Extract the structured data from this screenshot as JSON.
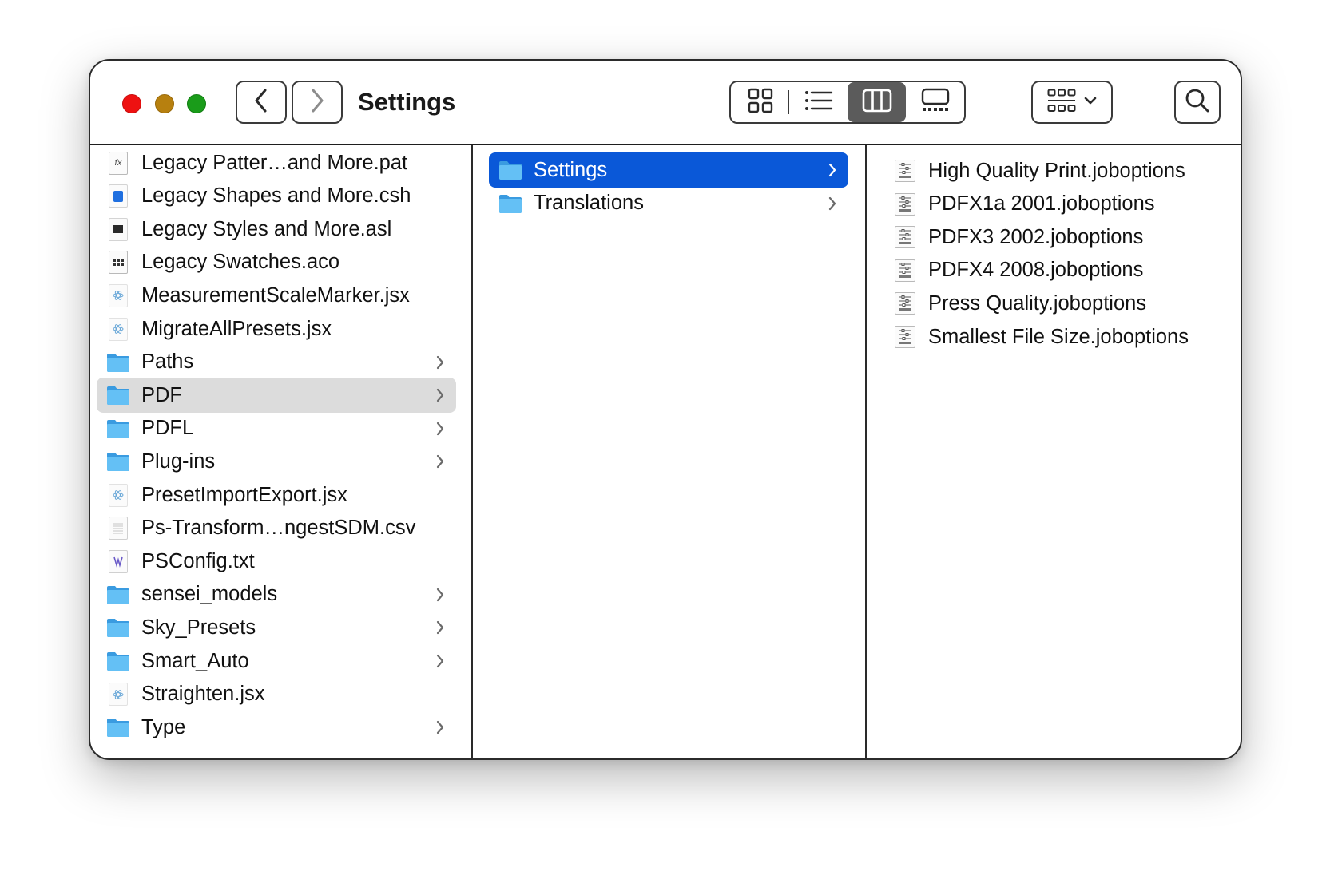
{
  "window": {
    "title": "Settings"
  },
  "toolbar": {
    "back_icon": "chevron-left-icon",
    "forward_icon": "chevron-right-icon",
    "views": [
      {
        "name": "icon-view",
        "icon": "grid-icon",
        "active": false
      },
      {
        "name": "list-view",
        "icon": "list-icon",
        "active": false
      },
      {
        "name": "column-view",
        "icon": "columns-icon",
        "active": true
      },
      {
        "name": "gallery-view",
        "icon": "gallery-icon",
        "active": false
      }
    ],
    "group_icon": "group-grid-icon",
    "search_icon": "search-icon"
  },
  "colors": {
    "selection_blue": "#0a58d8",
    "selection_gray": "#dcdcdc",
    "folder_blue": "#52b5f0",
    "close_red": "#ee1111",
    "minimize_yellow": "#b7800f",
    "zoom_green": "#1a9c1a"
  },
  "column1": {
    "items": [
      {
        "label": "Legacy Patter…and More.pat",
        "kind": "pattern-file",
        "has_children": false
      },
      {
        "label": "Legacy Shapes and More.csh",
        "kind": "shapes-file",
        "has_children": false
      },
      {
        "label": "Legacy Styles and More.asl",
        "kind": "styles-file",
        "has_children": false
      },
      {
        "label": "Legacy Swatches.aco",
        "kind": "swatch-file",
        "has_children": false
      },
      {
        "label": "MeasurementScaleMarker.jsx",
        "kind": "script-file",
        "has_children": false
      },
      {
        "label": "MigrateAllPresets.jsx",
        "kind": "script-file",
        "has_children": false
      },
      {
        "label": "Paths",
        "kind": "folder",
        "has_children": true
      },
      {
        "label": "PDF",
        "kind": "folder",
        "has_children": true,
        "selected": true
      },
      {
        "label": "PDFL",
        "kind": "folder",
        "has_children": true
      },
      {
        "label": "Plug-ins",
        "kind": "folder",
        "has_children": true
      },
      {
        "label": "PresetImportExport.jsx",
        "kind": "script-file",
        "has_children": false
      },
      {
        "label": "Ps-Transform…ngestSDM.csv",
        "kind": "csv-file",
        "has_children": false
      },
      {
        "label": "PSConfig.txt",
        "kind": "text-file",
        "has_children": false
      },
      {
        "label": "sensei_models",
        "kind": "folder",
        "has_children": true
      },
      {
        "label": "Sky_Presets",
        "kind": "folder",
        "has_children": true
      },
      {
        "label": "Smart_Auto",
        "kind": "folder",
        "has_children": true
      },
      {
        "label": "Straighten.jsx",
        "kind": "script-file",
        "has_children": false
      },
      {
        "label": "Type",
        "kind": "folder",
        "has_children": true
      }
    ]
  },
  "column2": {
    "items": [
      {
        "label": "Settings",
        "kind": "folder",
        "has_children": true,
        "selected": true
      },
      {
        "label": "Translations",
        "kind": "folder",
        "has_children": true
      }
    ]
  },
  "column3": {
    "items": [
      {
        "label": "High Quality Print.joboptions",
        "kind": "joboptions-file"
      },
      {
        "label": "PDFX1a 2001.joboptions",
        "kind": "joboptions-file"
      },
      {
        "label": "PDFX3 2002.joboptions",
        "kind": "joboptions-file"
      },
      {
        "label": "PDFX4 2008.joboptions",
        "kind": "joboptions-file"
      },
      {
        "label": "Press Quality.joboptions",
        "kind": "joboptions-file"
      },
      {
        "label": "Smallest File Size.joboptions",
        "kind": "joboptions-file"
      }
    ]
  }
}
